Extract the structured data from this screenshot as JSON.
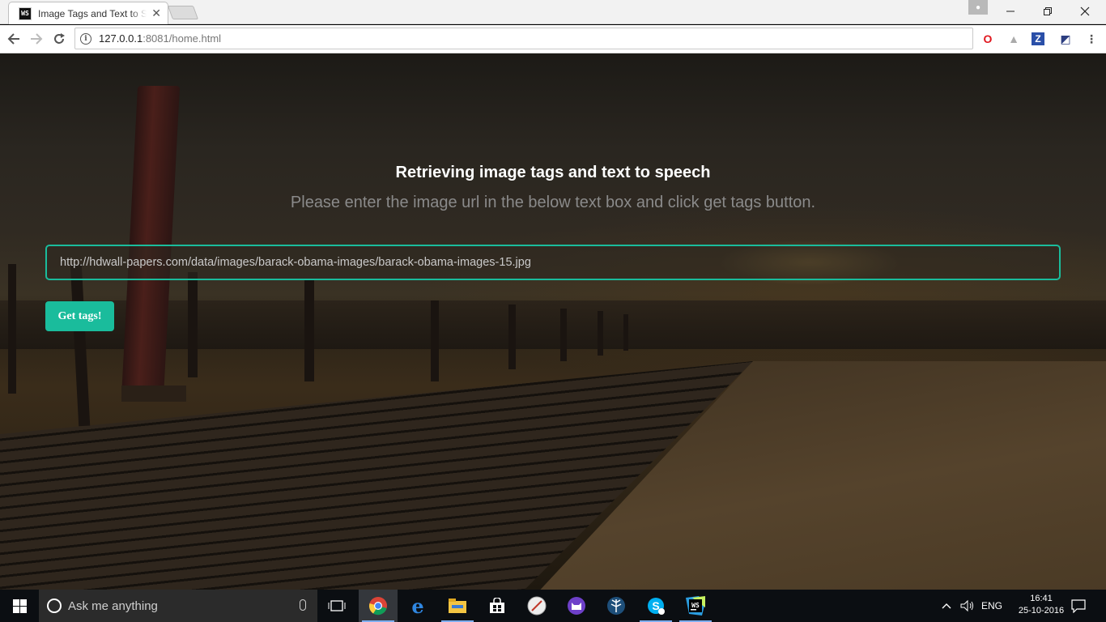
{
  "browser": {
    "tab_title": "Image Tags and Text to S",
    "tab_favicon": "WS",
    "url_host": "127.0.0.1",
    "url_path": ":8081/home.html",
    "icons": [
      "back-icon",
      "forward-icon",
      "reload-icon",
      "info-icon",
      "opera-icon",
      "drive-icon",
      "zotero-icon",
      "extension-icon",
      "menu-icon"
    ]
  },
  "page": {
    "headline": "Retrieving image tags and text to speech",
    "subline": "Please enter the image url in the below text box and click get tags button.",
    "url_input_value": "http://hdwall-papers.com/data/images/barack-obama-images/barack-obama-images-15.jpg",
    "button_label": "Get tags!",
    "accent_color": "#1abc9c"
  },
  "taskbar": {
    "search_placeholder": "Ask me anything",
    "language": "ENG",
    "time": "16:41",
    "date": "25-10-2016",
    "apps": [
      "task-view-icon",
      "chrome-icon",
      "edge-icon",
      "file-explorer-icon",
      "store-icon",
      "app-icon",
      "github-icon",
      "app2-icon",
      "skype-icon",
      "webstorm-icon"
    ]
  }
}
